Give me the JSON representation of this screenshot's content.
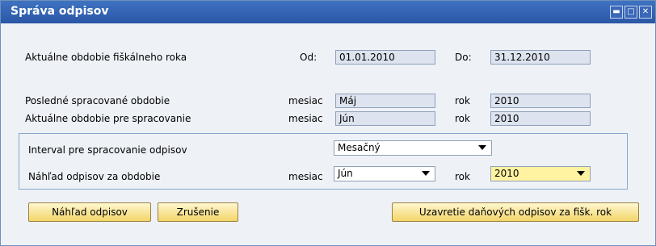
{
  "window": {
    "title": "Správa odpisov",
    "controls": [
      "minimize-icon",
      "maximize-icon",
      "close-icon"
    ]
  },
  "fiscal": {
    "label": "Aktuálne obdobie fiškálneho roka",
    "from_label": "Od:",
    "from_value": "01.01.2010",
    "to_label": "Do:",
    "to_value": "31.12.2010"
  },
  "last_processed": {
    "label": "Posledné spracované obdobie",
    "month_label": "mesiac",
    "month_value": "Máj",
    "year_label": "rok",
    "year_value": "2010"
  },
  "current_processing": {
    "label": "Aktuálne obdobie pre spracovanie",
    "month_label": "mesiac",
    "month_value": "Jún",
    "year_label": "rok",
    "year_value": "2010"
  },
  "interval": {
    "label": "Interval pre spracovanie odpisov",
    "selected": "Mesačný"
  },
  "preview_period": {
    "label": "Náhľad odpisov za obdobie",
    "month_label": "mesiac",
    "month_selected": "Jún",
    "year_label": "rok",
    "year_selected": "2010"
  },
  "buttons": {
    "preview": "Náhľad odpisov",
    "cancel": "Zrušenie",
    "close_tax": "Uzavretie daňových odpisov za fišk. rok"
  },
  "colors": {
    "titlebar": "#2f5fb3",
    "field_readonly": "#dde3ef",
    "field_highlight": "#fff2a0",
    "button": "#f6dc7e"
  }
}
